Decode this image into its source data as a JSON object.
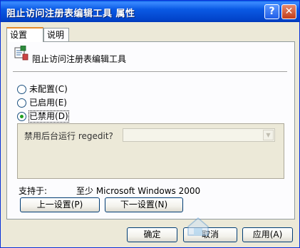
{
  "window": {
    "title": "阻止访问注册表编辑工具 属性"
  },
  "titlebar_buttons": {
    "help_glyph": "?",
    "close_glyph": "✕"
  },
  "tabs": [
    {
      "label": "设置",
      "active": true
    },
    {
      "label": "说明",
      "active": false
    }
  ],
  "policy": {
    "name": "阻止访问注册表编辑工具",
    "icon": "group-policy-setting-icon"
  },
  "state": {
    "selected": "disabled",
    "options": [
      {
        "id": "not_configured",
        "label": "未配置",
        "hotkey": "(C)"
      },
      {
        "id": "enabled",
        "label": "已启用",
        "hotkey": "(E)"
      },
      {
        "id": "disabled",
        "label": "已禁用",
        "hotkey": "(D)"
      }
    ]
  },
  "options_area": {
    "label": "禁用后台运行 regedit?",
    "value": ""
  },
  "supports": {
    "label": "支持于:",
    "value": "至少 Microsoft Windows 2000"
  },
  "nav_buttons": {
    "prev": "上一设置(P)",
    "next": "下一设置(N)"
  },
  "dialog_buttons": {
    "ok": "确定",
    "cancel": "取消",
    "apply": "应用(A)"
  },
  "watermark": {
    "text": "系统之家"
  },
  "colors": {
    "titlebar": "#0a5ae5",
    "face": "#ECE9D8",
    "tab_highlight": "#e68b2c",
    "radio_dot": "#21a121"
  }
}
